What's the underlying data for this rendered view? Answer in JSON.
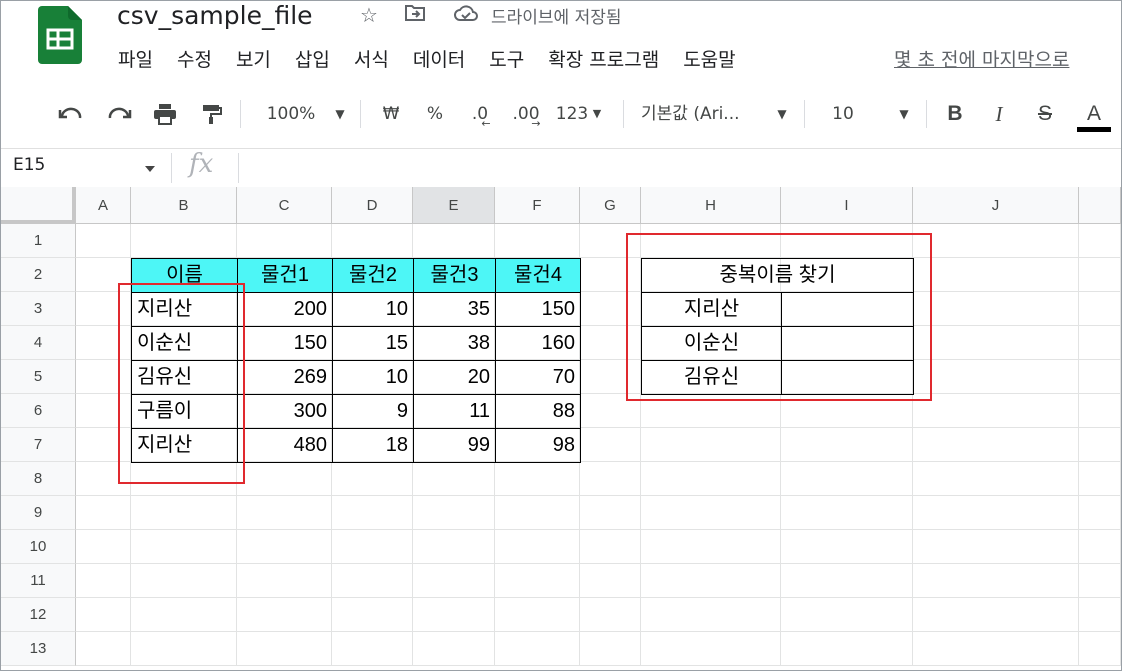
{
  "app": {
    "file_title": "csv_sample_file",
    "save_status": "드라이브에 저장됨",
    "last_edit": "몇 초 전에 마지막으로",
    "icons": [
      "star-icon",
      "move-to-folder-icon",
      "cloud-saved-icon"
    ]
  },
  "menu": [
    "파일",
    "수정",
    "보기",
    "삽입",
    "서식",
    "데이터",
    "도구",
    "확장 프로그램",
    "도움말"
  ],
  "toolbar": {
    "zoom": "100%",
    "currency": "₩",
    "percent": "%",
    "dec_decrease": ".0",
    "dec_increase": ".00",
    "number_format": "123",
    "font_family": "기본값 (Ari...",
    "font_size": "10",
    "bold": "B",
    "italic": "I",
    "strike": "S",
    "text_color": "A"
  },
  "formula_bar": {
    "name_box": "E15",
    "fx": "fx"
  },
  "sheet": {
    "columns": [
      "A",
      "B",
      "C",
      "D",
      "E",
      "F",
      "G",
      "H",
      "I",
      "J"
    ],
    "rows": [
      "1",
      "2",
      "3",
      "4",
      "5",
      "6",
      "7",
      "8",
      "9",
      "10",
      "11",
      "12",
      "13"
    ],
    "selected_column": "E",
    "table_header": [
      "이름",
      "물건1",
      "물건2",
      "물건3",
      "물건4"
    ],
    "table_rows": [
      [
        "지리산",
        "200",
        "10",
        "35",
        "150"
      ],
      [
        "이순신",
        "150",
        "15",
        "38",
        "160"
      ],
      [
        "김유신",
        "269",
        "10",
        "20",
        "70"
      ],
      [
        "구름이",
        "300",
        "9",
        "11",
        "88"
      ],
      [
        "지리산",
        "480",
        "18",
        "99",
        "98"
      ]
    ],
    "lookup_title": "중복이름 찾기",
    "lookup_names": [
      "지리산",
      "이순신",
      "김유신"
    ],
    "colors": {
      "header_fill": "#4df6f6",
      "highlight_border": "#e0292e",
      "brand_green": "#188038"
    }
  }
}
